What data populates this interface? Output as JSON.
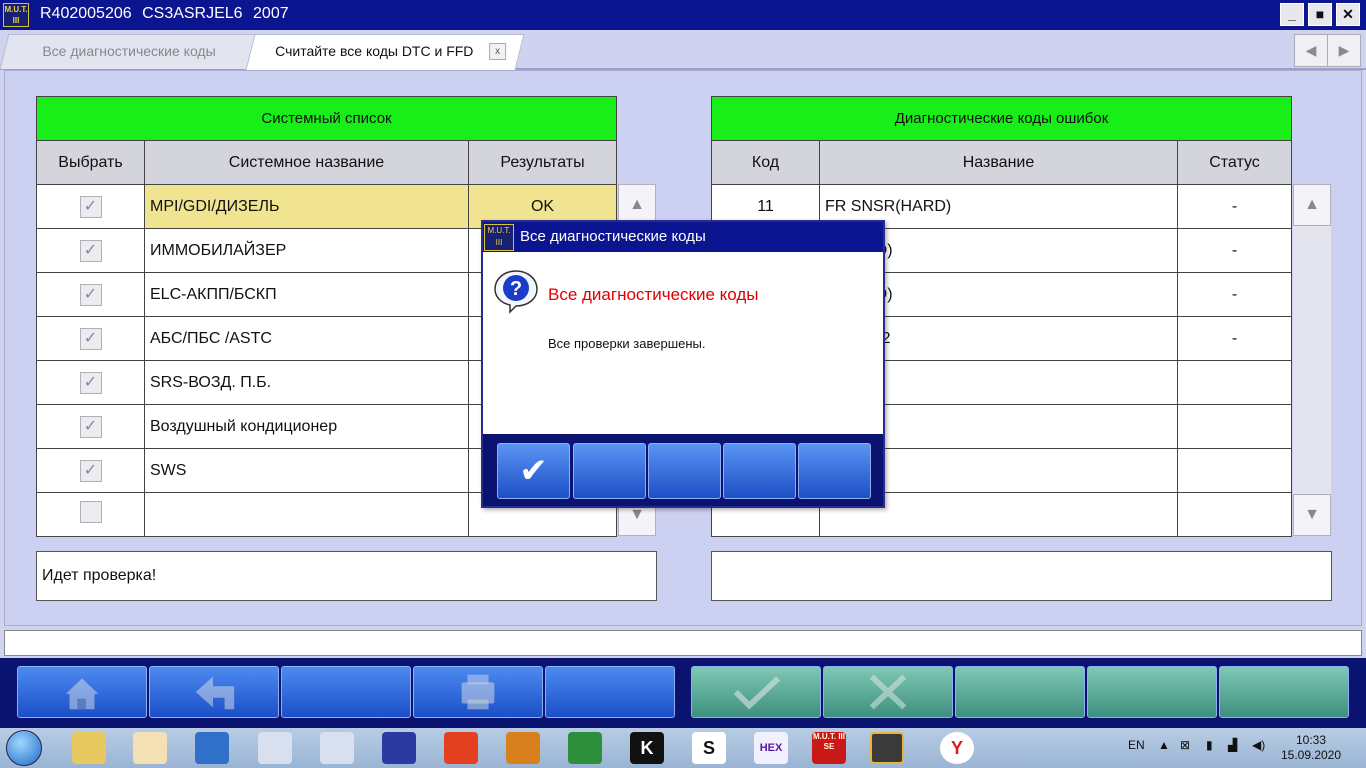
{
  "window": {
    "logo_text": "M.U.T. III",
    "title": "R402005206   CS3ASRJEL6 2007",
    "buttons": [
      "_",
      "■",
      "✕"
    ]
  },
  "tabs": [
    {
      "label": "Все диагностические коды",
      "active": false
    },
    {
      "label": "Считайте все коды DTC и FFD",
      "active": true,
      "close": "x"
    }
  ],
  "nav": {
    "prev": "◀",
    "next": "▶"
  },
  "system_list": {
    "title": "Системный список",
    "columns": [
      "Выбрать",
      "Системное название",
      "Результаты"
    ],
    "rows": [
      {
        "checked": true,
        "name": "MPI/GDI/ДИЗЕЛЬ",
        "result": "OK"
      },
      {
        "checked": true,
        "name": "ИММОБИЛАЙЗЕР",
        "result": ""
      },
      {
        "checked": true,
        "name": "ELC-АКПП/БСКП",
        "result": ""
      },
      {
        "checked": true,
        "name": "АБС/ПБС /ASTC",
        "result": ""
      },
      {
        "checked": true,
        "name": "SRS-ВОЗД. П.Б.",
        "result": ""
      },
      {
        "checked": true,
        "name": "Воздушный кондиционер",
        "result": ""
      },
      {
        "checked": true,
        "name": "SWS",
        "result": ""
      },
      {
        "checked": false,
        "name": "",
        "result": ""
      }
    ],
    "status": "Идет проверка!"
  },
  "dtc_list": {
    "title": "Диагностические коды ошибок",
    "columns": [
      "Код",
      "Название",
      "Статус"
    ],
    "rows": [
      {
        "code": "11",
        "name": "FR SNSR(HARD)",
        "status": "-"
      },
      {
        "code": "",
        "name": "R(HARD)",
        "status": "-"
      },
      {
        "code": "",
        "name": "R(HARD)",
        "status": "-"
      },
      {
        "code": "",
        "name": "R TRBL2",
        "status": "-"
      },
      {
        "code": "",
        "name": "",
        "status": ""
      },
      {
        "code": "",
        "name": "",
        "status": ""
      },
      {
        "code": "",
        "name": "",
        "status": ""
      },
      {
        "code": "",
        "name": "",
        "status": ""
      }
    ],
    "status": ""
  },
  "dialog": {
    "logo_text": "M.U.T. III",
    "title": "Все диагностические коды",
    "heading": "Все диагностические коды",
    "message": "Все проверки завершены.",
    "ok_symbol": "✔"
  },
  "toolbar": {
    "left_icons": [
      "home-icon",
      "back-icon",
      "",
      "printer-icon",
      ""
    ],
    "right_icons": [
      "checkmark-icon",
      "cancel-icon",
      "",
      "",
      ""
    ]
  },
  "taskbar": {
    "language": "EN",
    "time": "10:33",
    "date": "15.09.2020",
    "apps": [
      "explorer",
      "paint",
      "computer",
      "search-tool",
      "search-tool-2",
      "floppy",
      "no-sign",
      "camera",
      "road-app",
      "K",
      "S",
      "HEX",
      "M.U.T. III SE",
      "mmc",
      "Y"
    ]
  },
  "colors": {
    "title_bar": "#0c1590",
    "header_green": "#18ef18",
    "selected_row": "#f0e490",
    "dialog_heading": "#e00000"
  }
}
